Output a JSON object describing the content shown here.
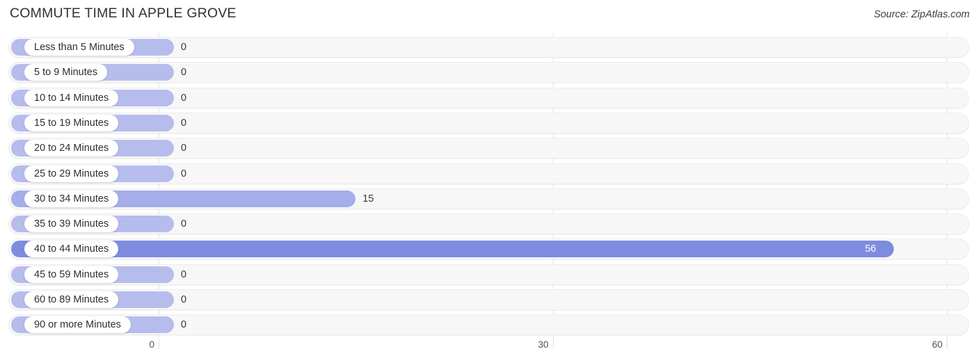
{
  "header": {
    "title": "COMMUTE TIME IN APPLE GROVE",
    "source": "Source: ZipAtlas.com"
  },
  "chart_data": {
    "type": "bar",
    "orientation": "horizontal",
    "title": "COMMUTE TIME IN APPLE GROVE",
    "subtitle": "",
    "xlabel": "",
    "ylabel": "",
    "xlim": [
      0,
      60
    ],
    "xticks": [
      0,
      30,
      60
    ],
    "xtick_labels": [
      "0",
      "30",
      "60"
    ],
    "grid": true,
    "legend": false,
    "categories": [
      "Less than 5 Minutes",
      "5 to 9 Minutes",
      "10 to 14 Minutes",
      "15 to 19 Minutes",
      "20 to 24 Minutes",
      "25 to 29 Minutes",
      "30 to 34 Minutes",
      "35 to 39 Minutes",
      "40 to 44 Minutes",
      "45 to 59 Minutes",
      "60 to 89 Minutes",
      "90 or more Minutes"
    ],
    "values": [
      0,
      0,
      0,
      0,
      0,
      0,
      15,
      0,
      56,
      0,
      0,
      0
    ],
    "value_labels": [
      "0",
      "0",
      "0",
      "0",
      "0",
      "0",
      "15",
      "0",
      "56",
      "0",
      "0",
      "0"
    ],
    "bar_colors": [
      "#b6bdec",
      "#b6bdec",
      "#b6bdec",
      "#b6bdec",
      "#b6bdec",
      "#b6bdec",
      "#a5adea",
      "#b6bdec",
      "#7d8cdf",
      "#b6bdec",
      "#b6bdec",
      "#b6bdec"
    ],
    "track_color": "#f7f7f7",
    "gridline_color": "#e3e3e3"
  }
}
